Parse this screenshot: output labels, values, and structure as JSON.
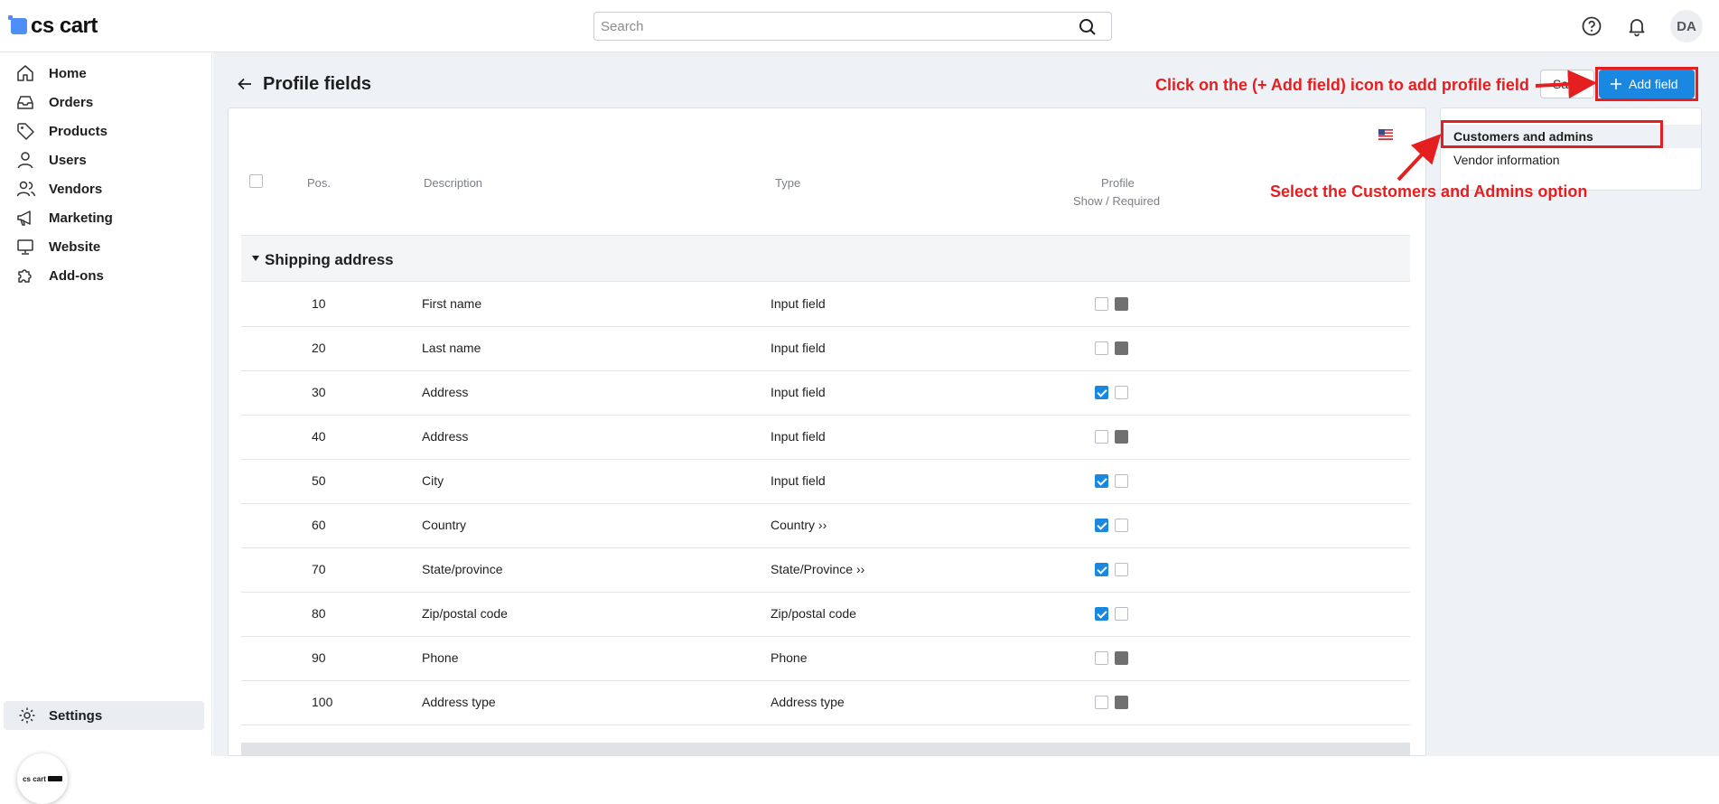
{
  "brand": {
    "logo_text": "cs cart",
    "bubble_text": "cs cart"
  },
  "search": {
    "placeholder": "Search"
  },
  "user": {
    "initials": "DA"
  },
  "sidebar": {
    "items": [
      {
        "label": "Home",
        "icon": "home-icon"
      },
      {
        "label": "Orders",
        "icon": "inbox-icon"
      },
      {
        "label": "Products",
        "icon": "tag-icon"
      },
      {
        "label": "Users",
        "icon": "user-icon"
      },
      {
        "label": "Vendors",
        "icon": "users-icon"
      },
      {
        "label": "Marketing",
        "icon": "megaphone-icon"
      },
      {
        "label": "Website",
        "icon": "monitor-icon"
      },
      {
        "label": "Add-ons",
        "icon": "puzzle-icon"
      }
    ],
    "settings_label": "Settings"
  },
  "page": {
    "title": "Profile fields",
    "save_label": "Save",
    "add_field_label": "Add field"
  },
  "table": {
    "headers": {
      "pos": "Pos.",
      "description": "Description",
      "type": "Type",
      "profile": "Profile",
      "show_required": "Show / Required"
    },
    "group": "Shipping address",
    "rows": [
      {
        "pos": "10",
        "description": "First name",
        "type": "Input field",
        "show": "unchecked",
        "required": "disabled"
      },
      {
        "pos": "20",
        "description": "Last name",
        "type": "Input field",
        "show": "unchecked",
        "required": "disabled"
      },
      {
        "pos": "30",
        "description": "Address",
        "type": "Input field",
        "show": "checked",
        "required": "unchecked"
      },
      {
        "pos": "40",
        "description": "Address",
        "type": "Input field",
        "show": "unchecked",
        "required": "disabled"
      },
      {
        "pos": "50",
        "description": "City",
        "type": "Input field",
        "show": "checked",
        "required": "unchecked"
      },
      {
        "pos": "60",
        "description": "Country",
        "type": "Country ››",
        "show": "checked",
        "required": "unchecked"
      },
      {
        "pos": "70",
        "description": "State/province",
        "type": "State/Province ››",
        "show": "checked",
        "required": "unchecked"
      },
      {
        "pos": "80",
        "description": "Zip/postal code",
        "type": "Zip/postal code",
        "show": "checked",
        "required": "unchecked"
      },
      {
        "pos": "90",
        "description": "Phone",
        "type": "Phone",
        "show": "unchecked",
        "required": "disabled"
      },
      {
        "pos": "100",
        "description": "Address type",
        "type": "Address type",
        "show": "unchecked",
        "required": "disabled"
      }
    ]
  },
  "dropdown": {
    "items": [
      "Customers and admins",
      "Vendor information"
    ]
  },
  "annotations": {
    "add_field": "Click on the (+ Add field) icon to add profile field",
    "select_option": "Select the Customers and Admins option"
  },
  "colors": {
    "accent": "#1a88e0",
    "annotation": "#e51f1f",
    "background": "#eef1f5"
  }
}
